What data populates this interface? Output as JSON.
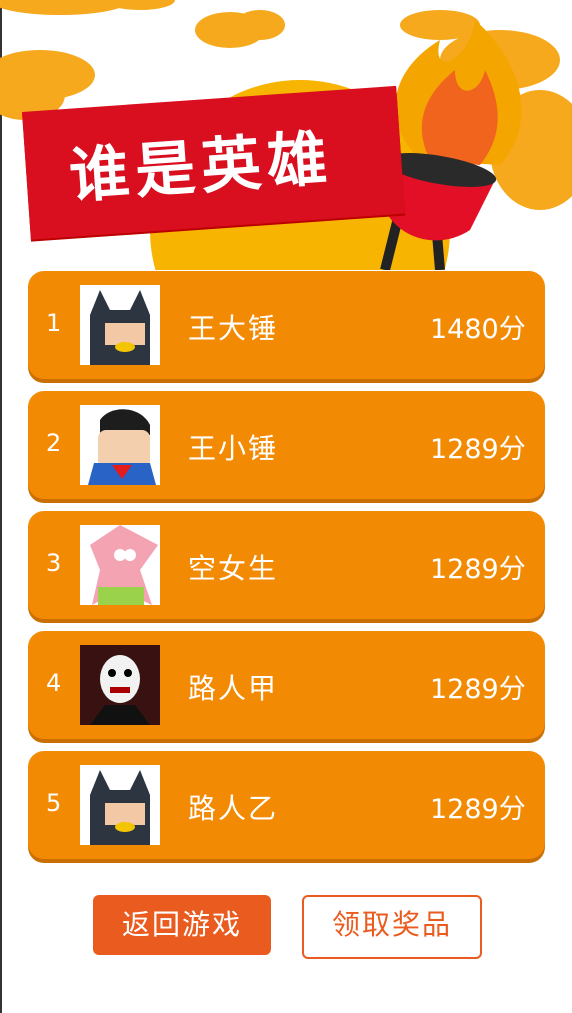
{
  "header": {
    "title": "谁是英雄",
    "colors": {
      "banner": "#d90f1f",
      "sun": "#f7b400",
      "cloud": "#f6a91c",
      "torch": "#e30f27"
    }
  },
  "rankings": [
    {
      "rank": "1",
      "name": "王大锤",
      "score": "1480分",
      "avatar": "batman-avatar"
    },
    {
      "rank": "2",
      "name": "王小锤",
      "score": "1289分",
      "avatar": "superman-avatar"
    },
    {
      "rank": "3",
      "name": "空女生",
      "score": "1289分",
      "avatar": "starfish-avatar"
    },
    {
      "rank": "4",
      "name": "路人甲",
      "score": "1289分",
      "avatar": "jigsaw-avatar"
    },
    {
      "rank": "5",
      "name": "路人乙",
      "score": "1289分",
      "avatar": "batman-avatar"
    }
  ],
  "buttons": {
    "back_label": "返回游戏",
    "prize_label": "领取奖品"
  },
  "colors": {
    "row": "#f38a03",
    "button_accent": "#e95b1f"
  }
}
